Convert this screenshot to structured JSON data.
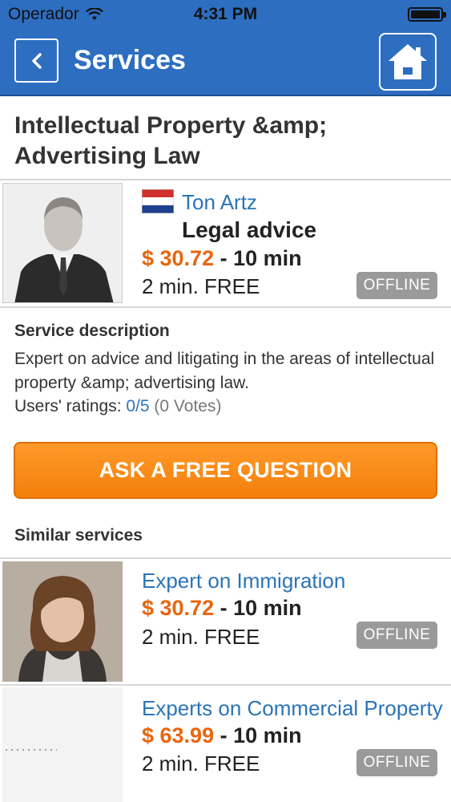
{
  "status_bar": {
    "carrier": "Operador",
    "time": "4:31 PM"
  },
  "nav": {
    "title": "Services",
    "back_icon": "chevron-left-icon",
    "home_icon": "home-icon",
    "bar_color": "#2d6ec0"
  },
  "service": {
    "title": "Intellectual Property &amp; Advertising Law",
    "expert_name": "Ton Artz",
    "flag_icon": "netherlands-flag-icon",
    "service_name": "Legal advice",
    "price": "$ 30.72",
    "price_suffix": " - 10 min",
    "free_minutes": "2 min. FREE",
    "status": "OFFLINE"
  },
  "description": {
    "heading": "Service description",
    "text": "Expert on advice and litigating in the areas of intellectual property &amp; advertising law.",
    "ratings_label": "Users' ratings: ",
    "ratings_value": "0/5",
    "ratings_votes": " (0 Votes)"
  },
  "ask_button": {
    "label": "ASK A FREE QUESTION",
    "color": "#f7870f"
  },
  "similar": {
    "heading": "Similar services",
    "items": [
      {
        "title": "Expert on Immigration",
        "price": "$ 30.72",
        "price_suffix": " - 10 min",
        "free_minutes": "2 min. FREE",
        "status": "OFFLINE"
      },
      {
        "title": "Experts on Commercial Property",
        "price": "$ 63.99",
        "price_suffix": " - 10 min",
        "free_minutes": "2 min. FREE",
        "status": "OFFLINE"
      }
    ]
  }
}
